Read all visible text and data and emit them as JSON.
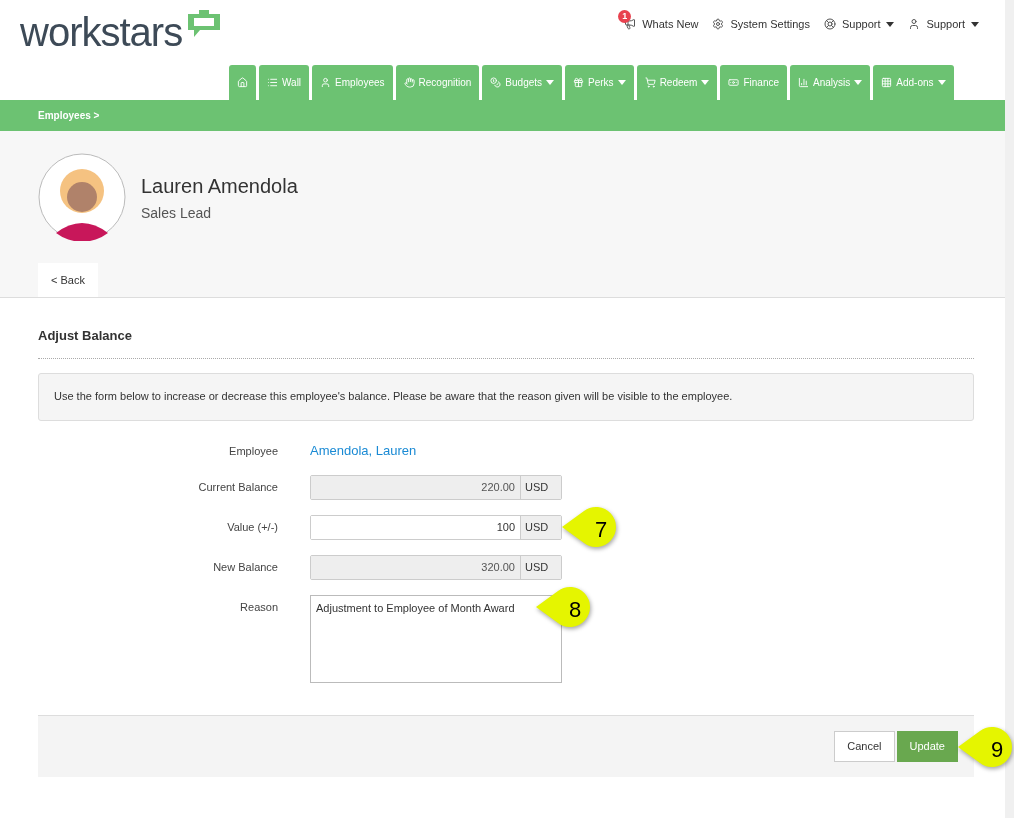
{
  "logo": {
    "text": "workstars"
  },
  "top_links": [
    {
      "label": "Whats New",
      "badge": "1",
      "has_menu": false
    },
    {
      "label": "System Settings",
      "has_menu": false
    },
    {
      "label": "Support",
      "has_menu": true
    },
    {
      "label": "Support",
      "has_menu": true
    }
  ],
  "nav_tabs": [
    {
      "has_menu": false
    },
    {
      "label": "Wall",
      "has_menu": false
    },
    {
      "label": "Employees",
      "has_menu": false
    },
    {
      "label": "Recognition",
      "has_menu": false
    },
    {
      "label": "Budgets",
      "has_menu": true
    },
    {
      "label": "Perks",
      "has_menu": true
    },
    {
      "label": "Redeem",
      "has_menu": true
    },
    {
      "label": "Finance",
      "has_menu": false
    },
    {
      "label": "Analysis",
      "has_menu": true
    },
    {
      "label": "Add-ons",
      "has_menu": true
    }
  ],
  "breadcrumb": "Employees >",
  "profile": {
    "name": "Lauren Amendola",
    "role": "Sales Lead"
  },
  "back_tab": "< Back",
  "section_title": "Adjust Balance",
  "notice": "Use the form below to increase or decrease this employee's balance. Please be aware that the reason given will be visible to the employee.",
  "form": [
    {
      "kind": "link",
      "label": "Employee",
      "value": "Amendola, Lauren"
    },
    {
      "kind": "readonly",
      "label": "Current Balance",
      "value": "220.00",
      "unit": "USD"
    },
    {
      "kind": "input",
      "label": "Value (+/-)",
      "value": "100",
      "unit": "USD",
      "callout": "7"
    },
    {
      "kind": "readonly",
      "label": "New Balance",
      "value": "320.00",
      "unit": "USD"
    },
    {
      "kind": "textarea",
      "label": "Reason",
      "value": "Adjustment to Employee of Month Award",
      "callout": "8"
    }
  ],
  "actions": [
    {
      "label": "Cancel",
      "primary": false
    },
    {
      "label": "Update",
      "primary": true,
      "callout": "9"
    }
  ]
}
